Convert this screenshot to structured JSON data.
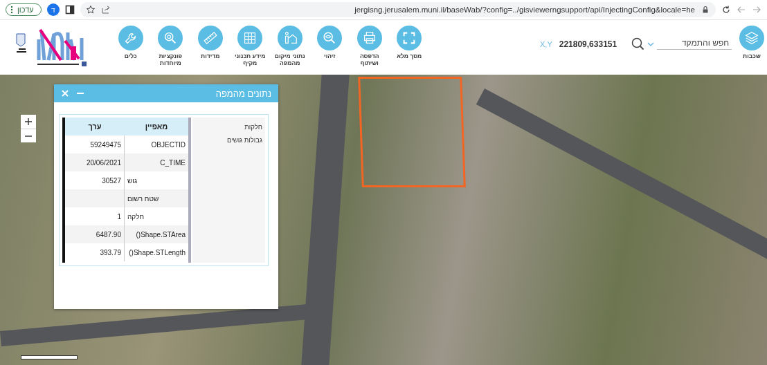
{
  "browser": {
    "update_button": "עדכון",
    "profile_initial": "ד",
    "url": "jergisng.jerusalem.muni.il/baseWab/?config=../gisviewerngsupport/api/InjectingConfig&locale=he"
  },
  "toolbar": {
    "tools": [
      {
        "kind": "fullscreen",
        "label": "מסך מלא"
      },
      {
        "kind": "printer",
        "label": "הדפסה ושיתוף"
      },
      {
        "kind": "eye",
        "label": "זיהוי"
      },
      {
        "kind": "person-house",
        "label": "נתוני מיקום מהמפה"
      },
      {
        "kind": "grid",
        "label": "מידע תכנוני מקיף"
      },
      {
        "kind": "ruler",
        "label": "מדידות"
      },
      {
        "kind": "magnifier",
        "label": "פונקציות מיוחדות"
      },
      {
        "kind": "wrench",
        "label": "כלים"
      }
    ],
    "coordinates": {
      "label": "X,Y",
      "value": "221809,633151"
    },
    "search": {
      "placeholder": "חפש והתמקד"
    },
    "layers": {
      "label": "שכבות"
    }
  },
  "popup": {
    "title": "נתונים מהמפה",
    "layers": [
      "חלקות",
      "גבולות גושים"
    ],
    "table": {
      "columns": [
        "מאפיין",
        "ערך"
      ],
      "rows": [
        {
          "value": "59249475",
          "attribute": "OBJECTID"
        },
        {
          "value": "20/06/2021",
          "attribute": "C_TIME"
        },
        {
          "value": "30527",
          "attribute": "גוש"
        },
        {
          "value": "",
          "attribute": "שטח רשום"
        },
        {
          "value": "1",
          "attribute": "חלקה"
        },
        {
          "value": "6487.90",
          "attribute": "()Shape.STArea"
        },
        {
          "value": "393.79",
          "attribute": "()Shape.STLength"
        }
      ]
    }
  }
}
